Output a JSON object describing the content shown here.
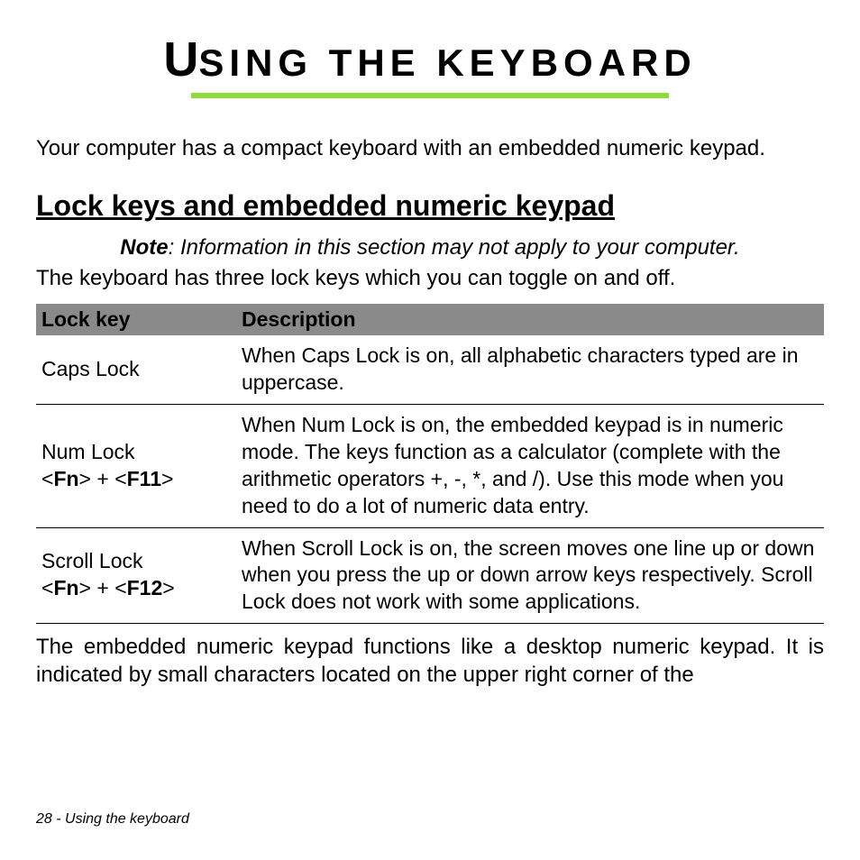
{
  "title_first": "U",
  "title_rest": "SING THE KEYBOARD",
  "intro": "Your computer has a compact keyboard with an embedded numeric keypad.",
  "section_heading": "Lock keys and embedded numeric keypad",
  "note_label": "Note",
  "note_text": ": Information in this section may not apply to your computer.",
  "lead": "The keyboard has three lock keys which you can toggle on and off.",
  "table": {
    "header": {
      "col1": "Lock key",
      "col2": "Description"
    },
    "rows": [
      {
        "key_html": "Caps Lock",
        "desc": "When Caps Lock is on, all alphabetic characters typed are in uppercase."
      },
      {
        "key_html": "Num Lock<br>&lt;<b>Fn</b>&gt; + &lt;<b>F11</b>&gt;",
        "desc": "When Num Lock is on, the embedded keypad is in numeric mode. The keys function as a calculator (complete with the arithmetic operators +, -, *, and /). Use this mode when you need to do a lot of numeric data entry."
      },
      {
        "key_html": "Scroll Lock<br>&lt;<b>Fn</b>&gt; + &lt;<b>F12</b>&gt;",
        "desc": "When Scroll Lock is on, the screen moves one line up or down when you press the up or down arrow keys respectively. Scroll Lock does not work with some applications."
      }
    ]
  },
  "after_table": "The embedded numeric keypad functions like a desktop numeric keypad. It is indicated by small characters located on the upper right corner of the",
  "footer": "28 - Using the keyboard"
}
